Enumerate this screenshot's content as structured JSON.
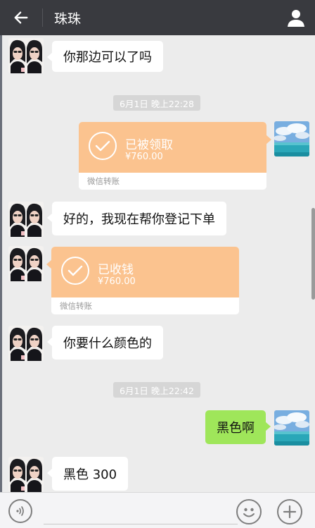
{
  "header": {
    "title": "珠珠",
    "back_icon": "arrow-left-icon",
    "profile_icon": "user-icon"
  },
  "messages": [
    {
      "type": "text",
      "side": "left",
      "text": "你那边可以了吗"
    },
    {
      "type": "time",
      "text": "6月1日 晚上22:28"
    },
    {
      "type": "transfer",
      "side": "right",
      "status": "已被领取",
      "amount": "¥760.00",
      "footer": "微信转账"
    },
    {
      "type": "text",
      "side": "left",
      "text": "好的，我现在帮你登记下单"
    },
    {
      "type": "transfer",
      "side": "left",
      "status": "已收钱",
      "amount": "¥760.00",
      "footer": "微信转账"
    },
    {
      "type": "text",
      "side": "left",
      "text": "你要什么颜色的"
    },
    {
      "type": "time",
      "text": "6月1日 晚上22:42"
    },
    {
      "type": "text",
      "side": "right",
      "text": "黑色啊"
    },
    {
      "type": "text",
      "side": "left",
      "text": "黑色 300"
    }
  ],
  "input_bar": {
    "voice_icon": "voice-icon",
    "emoji_icon": "emoji-icon",
    "plus_icon": "plus-icon"
  },
  "colors": {
    "header_bg": "#393a3f",
    "chat_bg": "#ececec",
    "sent_bubble": "#9fe65a",
    "transfer_card": "#fbc38f"
  }
}
